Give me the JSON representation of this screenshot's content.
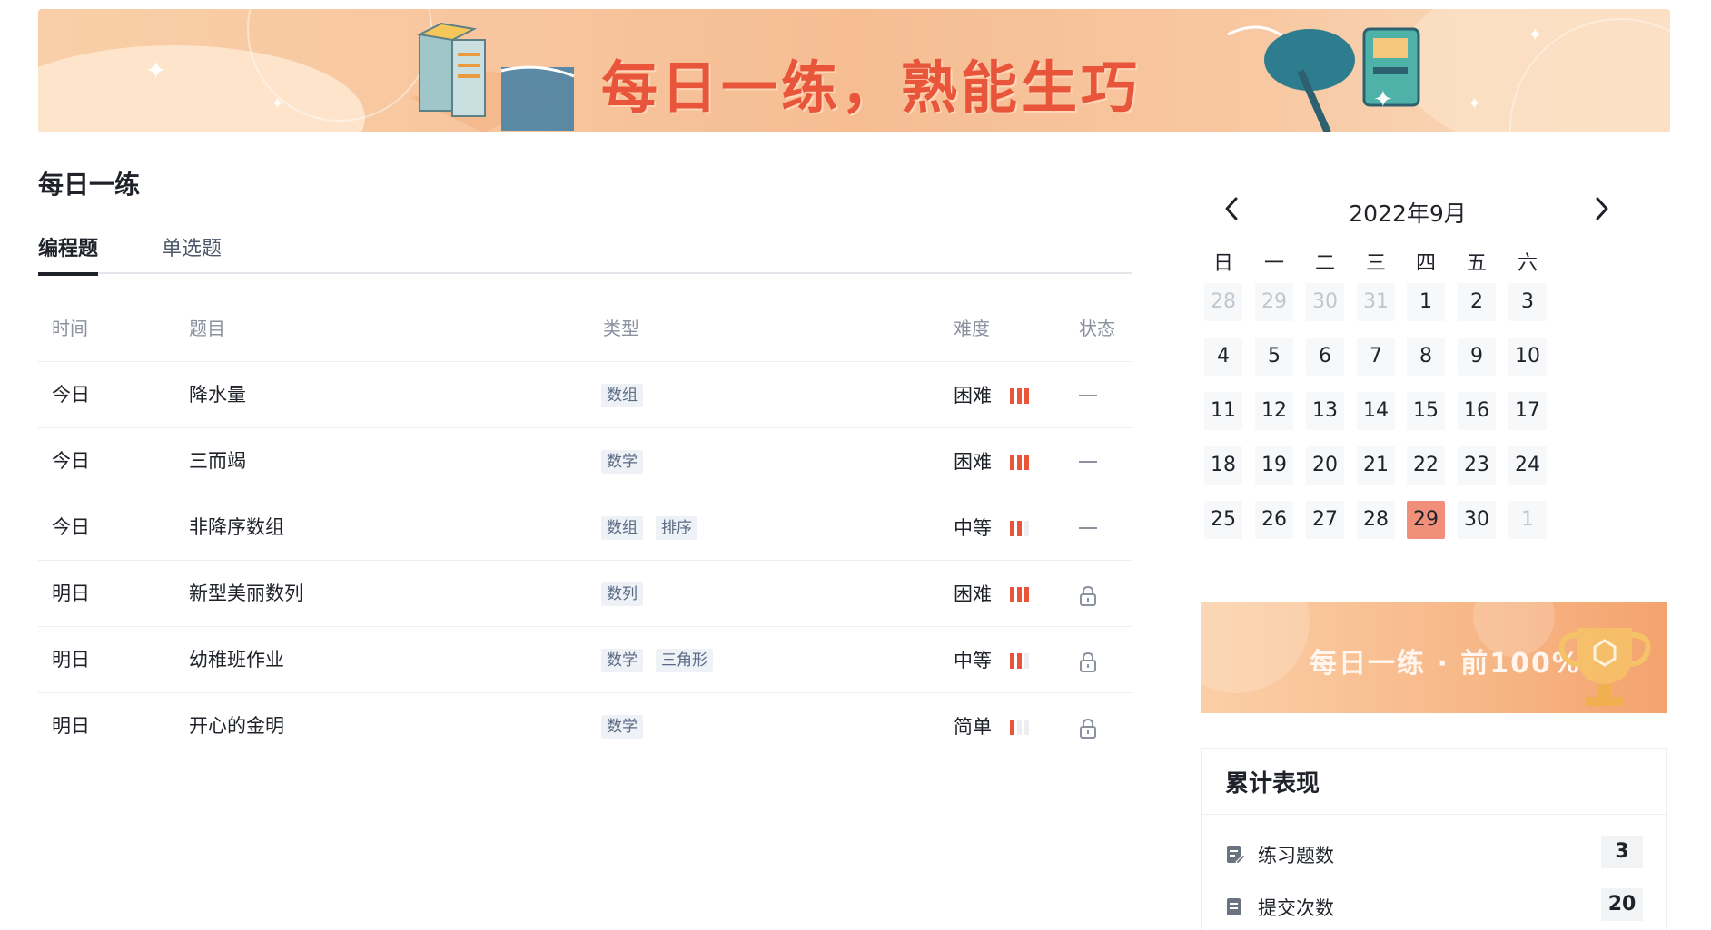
{
  "banner": {
    "title": "每日一练，熟能生巧"
  },
  "page": {
    "section_title": "每日一练"
  },
  "tabs": [
    {
      "label": "编程题",
      "active": true
    },
    {
      "label": "单选题",
      "active": false
    }
  ],
  "table": {
    "headers": {
      "time": "时间",
      "title": "题目",
      "type": "类型",
      "difficulty": "难度",
      "status": "状态"
    },
    "rows": [
      {
        "time": "今日",
        "title": "降水量",
        "tags": [
          "数组"
        ],
        "difficulty": "困难",
        "level": 3,
        "status": "dash"
      },
      {
        "time": "今日",
        "title": "三而竭",
        "tags": [
          "数学"
        ],
        "difficulty": "困难",
        "level": 3,
        "status": "dash"
      },
      {
        "time": "今日",
        "title": "非降序数组",
        "tags": [
          "数组",
          "排序"
        ],
        "difficulty": "中等",
        "level": 2,
        "status": "dash"
      },
      {
        "time": "明日",
        "title": "新型美丽数列",
        "tags": [
          "数列"
        ],
        "difficulty": "困难",
        "level": 3,
        "status": "locked"
      },
      {
        "time": "明日",
        "title": "幼稚班作业",
        "tags": [
          "数学",
          "三角形"
        ],
        "difficulty": "中等",
        "level": 2,
        "status": "locked"
      },
      {
        "time": "明日",
        "title": "开心的金明",
        "tags": [
          "数学"
        ],
        "difficulty": "简单",
        "level": 1,
        "status": "locked"
      }
    ]
  },
  "calendar": {
    "month_label": "2022年9月",
    "prev_icon": "chevron-left-icon",
    "next_icon": "chevron-right-icon",
    "weekdays": [
      "日",
      "一",
      "二",
      "三",
      "四",
      "五",
      "六"
    ],
    "weeks": [
      [
        {
          "d": "28",
          "other": true
        },
        {
          "d": "29",
          "other": true
        },
        {
          "d": "30",
          "other": true
        },
        {
          "d": "31",
          "other": true
        },
        {
          "d": "1"
        },
        {
          "d": "2"
        },
        {
          "d": "3"
        }
      ],
      [
        {
          "d": "4"
        },
        {
          "d": "5"
        },
        {
          "d": "6"
        },
        {
          "d": "7"
        },
        {
          "d": "8"
        },
        {
          "d": "9"
        },
        {
          "d": "10"
        }
      ],
      [
        {
          "d": "11"
        },
        {
          "d": "12"
        },
        {
          "d": "13"
        },
        {
          "d": "14"
        },
        {
          "d": "15"
        },
        {
          "d": "16"
        },
        {
          "d": "17"
        }
      ],
      [
        {
          "d": "18"
        },
        {
          "d": "19"
        },
        {
          "d": "20"
        },
        {
          "d": "21"
        },
        {
          "d": "22"
        },
        {
          "d": "23"
        },
        {
          "d": "24"
        }
      ],
      [
        {
          "d": "25"
        },
        {
          "d": "26"
        },
        {
          "d": "27"
        },
        {
          "d": "28"
        },
        {
          "d": "29",
          "today": true
        },
        {
          "d": "30"
        },
        {
          "d": "1",
          "other": true
        }
      ]
    ]
  },
  "promo": {
    "text": "每日一练 · 前100%"
  },
  "stats": {
    "title": "累计表现",
    "items": [
      {
        "label": "练习题数",
        "value": "3",
        "icon": "practice-icon"
      },
      {
        "label": "提交次数",
        "value": "20",
        "icon": "submit-icon"
      }
    ]
  },
  "colors": {
    "accent": "#e8553a",
    "today": "#f0907a",
    "tag_bg": "#eef1f6",
    "tag_text": "#5b6b85"
  }
}
